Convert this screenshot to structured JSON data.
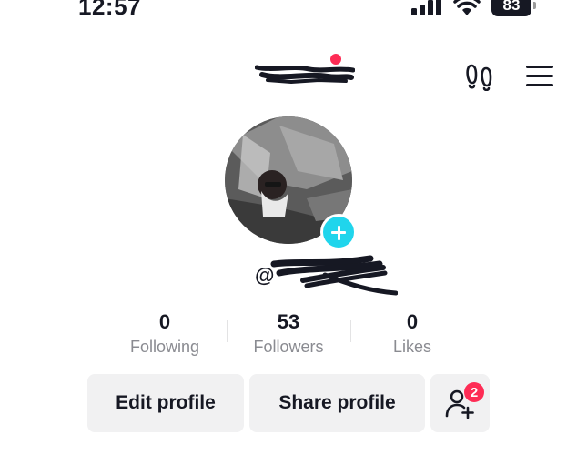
{
  "status_bar": {
    "time": "12:57",
    "battery": "83"
  },
  "header": {
    "username_redacted": true,
    "footprints_icon": "footprints-icon",
    "menu_icon": "hamburger-menu-icon"
  },
  "profile": {
    "handle_prefix": "@",
    "handle_redacted": true
  },
  "stats": [
    {
      "value": "0",
      "label": "Following"
    },
    {
      "value": "53",
      "label": "Followers"
    },
    {
      "value": "0",
      "label": "Likes"
    }
  ],
  "actions": {
    "edit_profile": "Edit profile",
    "share_profile": "Share profile",
    "add_friends_badge": "2"
  },
  "colors": {
    "accent_red": "#fe2c55",
    "accent_cyan": "#20d5ec",
    "button_bg": "#f1f1f2",
    "muted_text": "#8a8b91"
  }
}
